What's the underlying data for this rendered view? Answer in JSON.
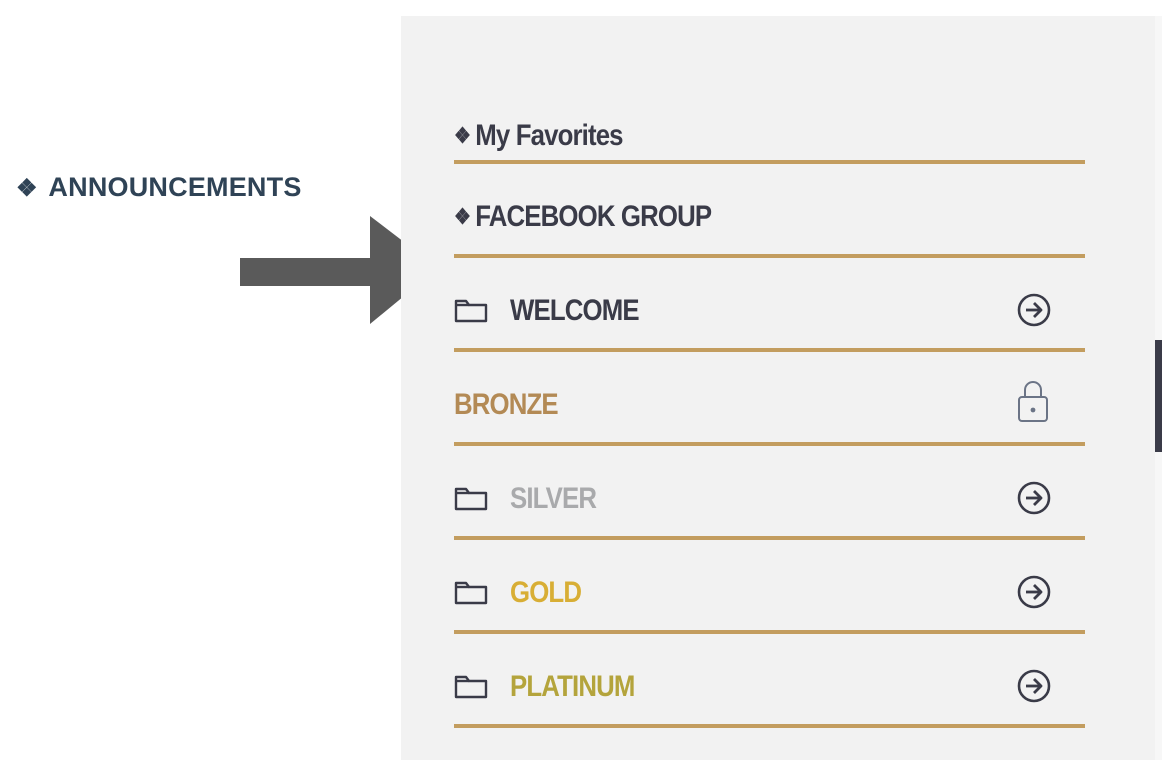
{
  "callout": {
    "bullet": "❖",
    "text": "ANNOUNCEMENTS"
  },
  "menu": {
    "items": [
      {
        "lead": "❖",
        "label": "My Favorites",
        "color": "#3a3b48",
        "icon": "none",
        "trail": "none"
      },
      {
        "lead": "❖",
        "label": "FACEBOOK GROUP",
        "color": "#3a3b48",
        "icon": "none",
        "trail": "none"
      },
      {
        "lead": "",
        "label": "WELCOME",
        "color": "#3a3b48",
        "icon": "folder-icon",
        "trail": "arrow-right-circle-icon"
      },
      {
        "lead": "",
        "label": "BRONZE",
        "color": "#b38a55",
        "icon": "none",
        "trail": "lock-icon"
      },
      {
        "lead": "",
        "label": "SILVER",
        "color": "#a9aaac",
        "icon": "folder-icon",
        "trail": "arrow-right-circle-icon"
      },
      {
        "lead": "",
        "label": "GOLD",
        "color": "#d8ae35",
        "icon": "folder-icon",
        "trail": "arrow-right-circle-icon"
      },
      {
        "lead": "",
        "label": "PLATINUM",
        "color": "#b4a43c",
        "icon": "folder-icon",
        "trail": "arrow-right-circle-icon"
      }
    ]
  },
  "colors": {
    "divider": "#c39d5f",
    "panel_bg": "#f2f2f2",
    "arrow": "#5a5a5a",
    "callout_text": "#2f4356",
    "icon": "#3a3b48",
    "scroll_thumb": "#3a3b48"
  }
}
